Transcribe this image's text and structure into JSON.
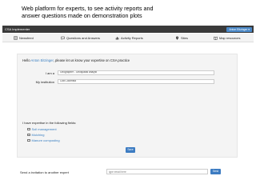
{
  "slide": {
    "caption_line1": "Web platform for experts, to see activity reports and",
    "caption_line2": "answer questions made on demonstration plots"
  },
  "header": {
    "brand": "CSA Implementer",
    "user_button": "Anton Eitzinger ▾"
  },
  "nav": {
    "items": [
      {
        "label": "Newsfeed",
        "icon": "newspaper-icon"
      },
      {
        "label": "Questions and Answers",
        "icon": "chat-icon"
      },
      {
        "label": "Activity Reports",
        "icon": "chart-icon"
      },
      {
        "label": "Sites",
        "icon": "map-pin-icon"
      },
      {
        "label": "Map resources",
        "icon": "book-icon"
      }
    ]
  },
  "profile": {
    "greeting_prefix": "Hello ",
    "user_name": "Anton Eitzinger",
    "greeting_suffix": ", please let us know your expertise on CSA practice",
    "role_label": "I am a",
    "role_value": "Geographer - Geospatial analyst",
    "institution_label": "My institution",
    "institution_value": "Ciat Colombia",
    "expertise_intro": "I have expertise in the following fields:",
    "options": [
      {
        "label": "Soil management",
        "checked": false
      },
      {
        "label": "Mulching",
        "checked": true
      },
      {
        "label": "Manure composting",
        "checked": false
      }
    ],
    "save_label": "Save"
  },
  "invite": {
    "label": "Send a invitation to another expert",
    "placeholder": "type email here",
    "send_label": "Send"
  },
  "colors": {
    "topbar": "#3a3a3a",
    "accent": "#3d7cc2",
    "link": "#3a7fc1"
  }
}
